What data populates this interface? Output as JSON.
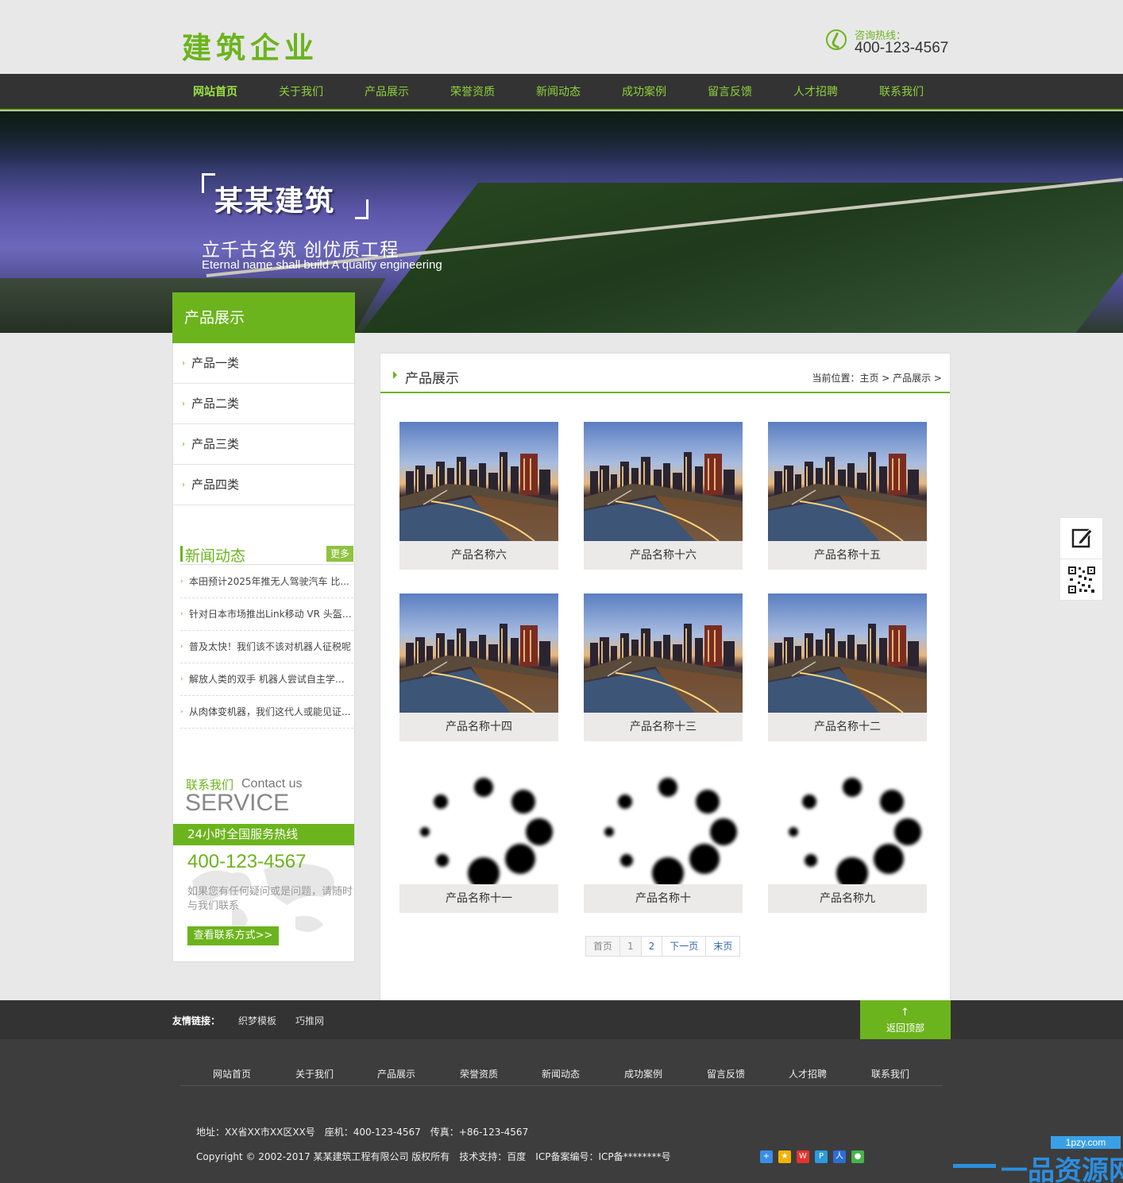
{
  "header": {
    "logo": "建筑企业",
    "hotline_label": "咨询热线：",
    "hotline_number": "400-123-4567"
  },
  "nav": [
    "网站首页",
    "关于我们",
    "产品展示",
    "荣誉资质",
    "新闻动态",
    "成功案例",
    "留言反馈",
    "人才招聘",
    "联系我们"
  ],
  "banner": {
    "title": "某某建筑",
    "slogan": "立千古名筑 创优质工程",
    "subtitle": "Eternal name shall build A quality engineering"
  },
  "sidebar": {
    "heading": "产品展示",
    "categories": [
      "产品一类",
      "产品二类",
      "产品三类",
      "产品四类"
    ],
    "news_title": "新闻动态",
    "news_more": "更多",
    "news": [
      "本田预计2025年推无人驾驶汽车 比...",
      "针对日本市场推出Link移动 VR 头盔:...",
      "普及太快！我们该不该对机器人征税呢",
      "解放人类的双手 机器人尝试自主学习...",
      "从肉体变机器，我们这代人或能见证..."
    ],
    "contact_cn": "联系我们",
    "contact_en": "Contact us",
    "service": "SERVICE",
    "hotline_bar": "24小时全国服务热线",
    "phone": "400-123-4567",
    "desc": "如果您有任何疑问或是问题，请随时与我们联系",
    "contact_btn": "查看联系方式>>"
  },
  "main": {
    "title": "产品展示",
    "breadcrumb": "当前位置：主页 > 产品展示 >",
    "products": [
      {
        "name": "产品名称六",
        "image": "city-night"
      },
      {
        "name": "产品名称十六",
        "image": "city-night"
      },
      {
        "name": "产品名称十五",
        "image": "city-night"
      },
      {
        "name": "产品名称十四",
        "image": "city-night"
      },
      {
        "name": "产品名称十三",
        "image": "city-night"
      },
      {
        "name": "产品名称十二",
        "image": "city-night"
      },
      {
        "name": "产品名称十一",
        "image": "loading-spinner"
      },
      {
        "name": "产品名称十",
        "image": "loading-spinner"
      },
      {
        "name": "产品名称九",
        "image": "loading-spinner"
      }
    ],
    "pager": [
      "首页",
      "1",
      "2",
      "下一页",
      "末页"
    ]
  },
  "links": {
    "label": "友情链接：",
    "items": [
      "织梦模板",
      "巧推网"
    ],
    "back_top": "返回顶部"
  },
  "footer": {
    "nav": [
      "网站首页",
      "关于我们",
      "产品展示",
      "荣誉资质",
      "新闻动态",
      "成功案例",
      "留言反馈",
      "人才招聘",
      "联系我们"
    ],
    "address": "地址：XX省XX市XX区XX号　座机：400-123-4567　传真：+86-123-4567",
    "copyright": "Copyright © 2002-2017 某某建筑工程有限公司 版权所有　技术支持：百度　ICP备案编号：ICP备********号",
    "watermark_small": "1pzy.com",
    "watermark_big": "一品资源网"
  },
  "colors": {
    "accent": "#6cb41e",
    "nav_bg": "#333333",
    "footer_bg": "#3d3d3d"
  }
}
